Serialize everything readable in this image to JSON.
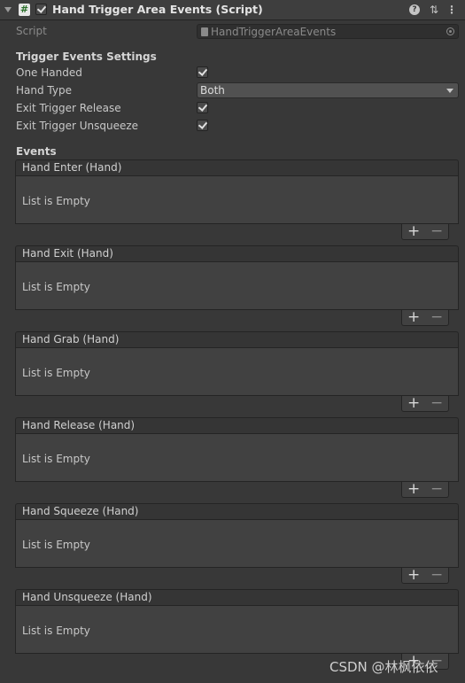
{
  "header": {
    "title": "Hand Trigger Area Events (Script)",
    "enabled": true,
    "icons": [
      "foldout-arrow-icon",
      "script-icon",
      "help-icon",
      "preset-sliders-icon",
      "kebab-menu-icon"
    ]
  },
  "script_field": {
    "label": "Script",
    "value": "HandTriggerAreaEvents"
  },
  "settings": {
    "heading": "Trigger Events Settings",
    "one_handed": {
      "label": "One Handed",
      "checked": true
    },
    "hand_type": {
      "label": "Hand Type",
      "value": "Both"
    },
    "exit_trigger_release": {
      "label": "Exit Trigger Release",
      "checked": true
    },
    "exit_trigger_unsqueeze": {
      "label": "Exit Trigger Unsqueeze",
      "checked": true
    }
  },
  "events": {
    "heading": "Events",
    "list": [
      {
        "title": "Hand Enter (Hand)",
        "empty": "List is Empty"
      },
      {
        "title": "Hand Exit (Hand)",
        "empty": "List is Empty"
      },
      {
        "title": "Hand Grab (Hand)",
        "empty": "List is Empty"
      },
      {
        "title": "Hand Release (Hand)",
        "empty": "List is Empty"
      },
      {
        "title": "Hand Squeeze (Hand)",
        "empty": "List is Empty"
      },
      {
        "title": "Hand Unsqueeze (Hand)",
        "empty": "List is Empty"
      }
    ],
    "add_label": "+",
    "remove_label": "−"
  },
  "watermark": "CSDN @林枫依依",
  "colors": {
    "background": "#383838",
    "header": "#3e3e3e",
    "list_body": "#414141",
    "dropdown": "#515151"
  }
}
